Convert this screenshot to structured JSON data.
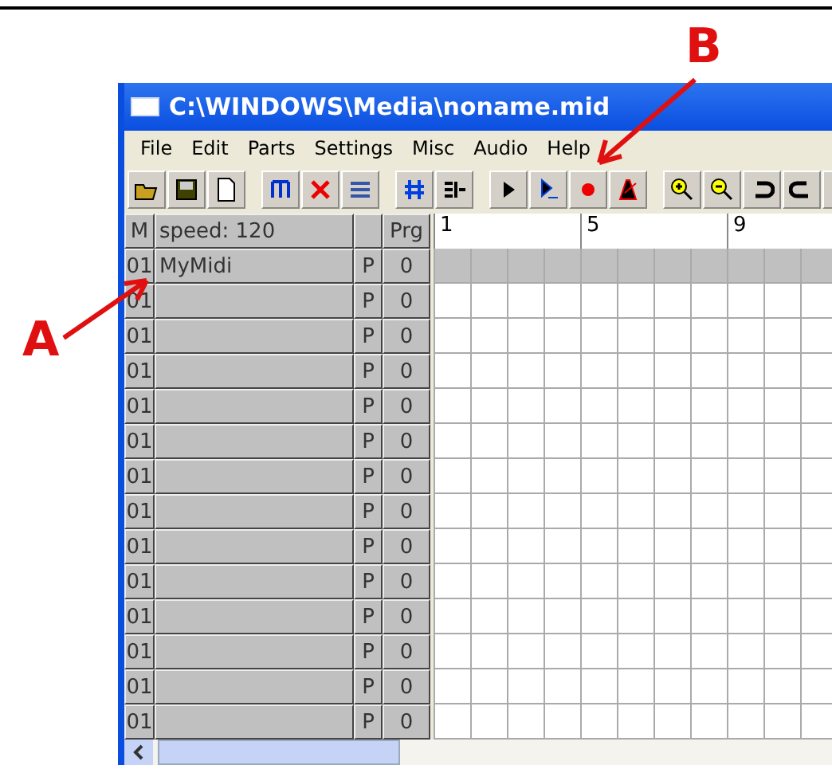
{
  "annotations": [
    {
      "label": "A"
    },
    {
      "label": "B"
    }
  ],
  "window": {
    "title": "C:\\WINDOWS\\Media\\noname.mid"
  },
  "menu": [
    "File",
    "Edit",
    "Parts",
    "Settings",
    "Misc",
    "Audio",
    "Help"
  ],
  "header": {
    "m": "M",
    "name": "speed: 120",
    "prg": "Prg"
  },
  "ruler": [
    "1",
    "5",
    "9"
  ],
  "tracks": [
    {
      "channel": "01",
      "name": "MyMidi",
      "mode": "P",
      "program": "0",
      "selected": true
    },
    {
      "channel": "01",
      "mode": "P",
      "program": "0",
      "selected": false
    },
    {
      "channel": "01",
      "mode": "P",
      "program": "0",
      "selected": false
    },
    {
      "channel": "01",
      "mode": "P",
      "program": "0",
      "selected": false
    },
    {
      "channel": "01",
      "mode": "P",
      "program": "0",
      "selected": false
    },
    {
      "channel": "01",
      "mode": "P",
      "program": "0",
      "selected": false
    },
    {
      "channel": "01",
      "mode": "P",
      "program": "0",
      "selected": false
    },
    {
      "channel": "01",
      "mode": "P",
      "program": "0",
      "selected": false
    },
    {
      "channel": "01",
      "mode": "P",
      "program": "0",
      "selected": false
    },
    {
      "channel": "01",
      "mode": "P",
      "program": "0",
      "selected": false
    },
    {
      "channel": "01",
      "mode": "P",
      "program": "0",
      "selected": false
    },
    {
      "channel": "01",
      "mode": "P",
      "program": "0",
      "selected": false
    },
    {
      "channel": "01",
      "mode": "P",
      "program": "0",
      "selected": false
    },
    {
      "channel": "01",
      "mode": "P",
      "program": "0",
      "selected": false
    }
  ]
}
